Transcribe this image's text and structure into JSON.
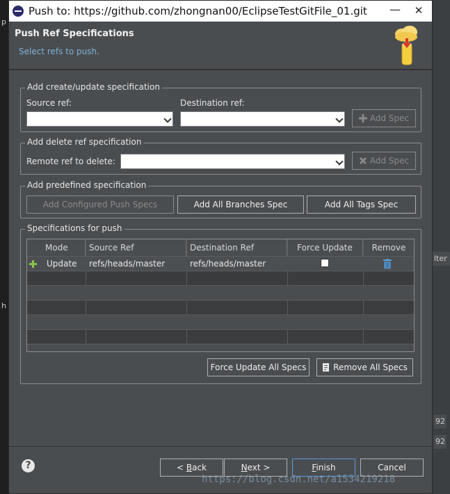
{
  "window": {
    "title": "Push to: https://github.com/zhongnan00/EclipseTestGitFile_01.git",
    "minimize_glyph": "—",
    "close_glyph": "✕"
  },
  "header": {
    "title": "Push Ref Specifications",
    "description": "Select refs to push.",
    "icon": "cloud-push-icon"
  },
  "create_group": {
    "title": "Add create/update specification",
    "source_label": "Source ref:",
    "source_value": "",
    "destination_label": "Destination ref:",
    "destination_value": "",
    "add_spec_label": "Add Spec"
  },
  "delete_group": {
    "title": "Add delete ref specification",
    "remote_label": "Remote ref to delete:",
    "remote_value": "",
    "add_spec_label": "Add Spec"
  },
  "predefined_group": {
    "title": "Add predefined specification",
    "configured_label": "Add Configured Push Specs",
    "all_branches_label": "Add All Branches Spec",
    "all_tags_label": "Add All Tags Spec"
  },
  "push_group": {
    "title": "Specifications for push",
    "columns": [
      "Mode",
      "Source Ref",
      "Destination Ref",
      "Force Update",
      "Remove"
    ],
    "rows": [
      {
        "mode": "Update",
        "source": "refs/heads/master",
        "destination": "refs/heads/master",
        "force": false
      }
    ],
    "force_all_label": "Force Update All Specs",
    "remove_all_label": "Remove All Specs"
  },
  "footer": {
    "back_mnemonic": "B",
    "back_rest": "ack",
    "back_prefix": "< ",
    "next_mnemonic": "N",
    "next_rest": "ext >",
    "finish_mnemonic": "F",
    "finish_rest": "inish",
    "cancel_label": "Cancel"
  },
  "background": {
    "frag1": "p",
    "frag2": "lter",
    "frag3": "h",
    "frag4": "92",
    "frag5": "92"
  },
  "watermark": "https://blog.csdn.net/a1534219218"
}
